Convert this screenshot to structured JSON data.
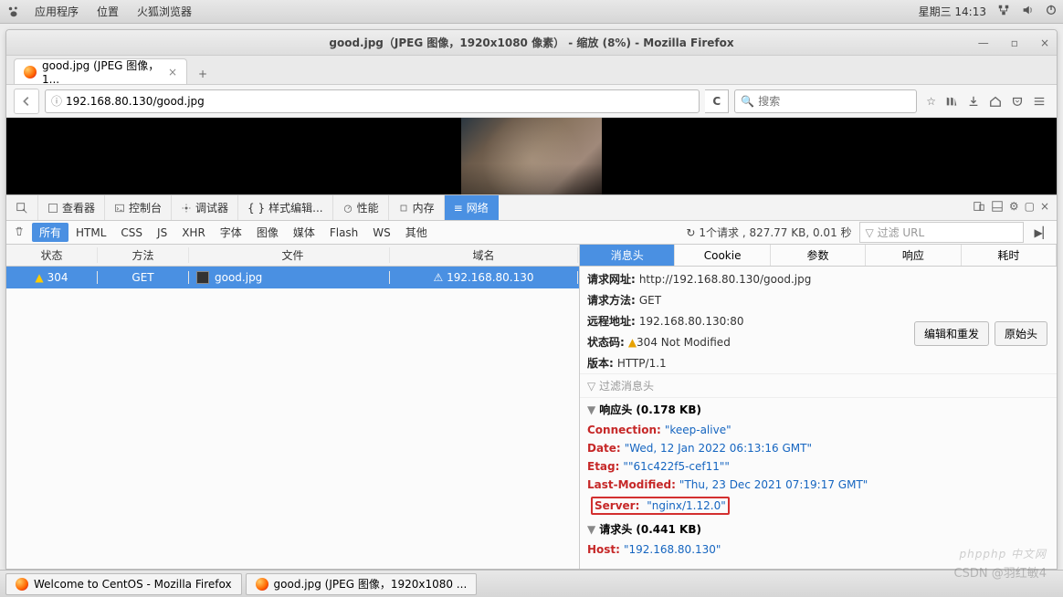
{
  "gnome": {
    "menu": [
      "应用程序",
      "位置",
      "火狐浏览器"
    ],
    "clock": "星期三  14:13"
  },
  "window": {
    "title": "good.jpg（JPEG 图像，1920x1080 像素）  - 缩放 (8%)  -  Mozilla Firefox"
  },
  "tab": {
    "label": "good.jpg (JPEG 图像，1...",
    "close": "×",
    "new": "+"
  },
  "urlbar": {
    "info": "ⓘ",
    "url": "192.168.80.130/good.jpg",
    "go": "C",
    "search_icon": "🔍",
    "search_placeholder": "搜索"
  },
  "devtools": {
    "tabs": {
      "inspector": "查看器",
      "console": "控制台",
      "debugger": "调试器",
      "style": "样式编辑...",
      "performance": "性能",
      "memory": "内存",
      "network": "网络"
    },
    "filters": {
      "all": "所有",
      "html": "HTML",
      "css": "CSS",
      "js": "JS",
      "xhr": "XHR",
      "fonts": "字体",
      "images": "图像",
      "media": "媒体",
      "flash": "Flash",
      "ws": "WS",
      "other": "其他"
    },
    "summary": "1个请求 , 827.77 KB, 0.01 秒",
    "filter_url_placeholder": "过滤 URL",
    "req_columns": {
      "status": "状态",
      "method": "方法",
      "file": "文件",
      "domain": "域名"
    },
    "request": {
      "status": "304",
      "method": "GET",
      "file": "good.jpg",
      "domain": "192.168.80.130"
    },
    "sidetabs": {
      "headers": "消息头",
      "cookies": "Cookie",
      "params": "参数",
      "response": "响应",
      "timing": "耗时"
    },
    "headers": {
      "url_k": "请求网址:",
      "url_v": "http://192.168.80.130/good.jpg",
      "method_k": "请求方法:",
      "method_v": "GET",
      "remote_k": "远程地址:",
      "remote_v": "192.168.80.130:80",
      "status_k": "状态码:",
      "status_v": "304 Not Modified",
      "version_k": "版本:",
      "version_v": "HTTP/1.1",
      "edit_btn": "编辑和重发",
      "raw_btn": "原始头",
      "filter_placeholder": "过滤消息头",
      "response_section": "响应头 (0.178 KB)",
      "connection_k": "Connection:",
      "connection_v": "\"keep-alive\"",
      "date_k": "Date:",
      "date_v": "\"Wed, 12 Jan 2022 06:13:16 GMT\"",
      "etag_k": "Etag:",
      "etag_v": "\"\"61c422f5-cef11\"\"",
      "lastmod_k": "Last-Modified:",
      "lastmod_v": "\"Thu, 23 Dec 2021 07:19:17 GMT\"",
      "server_k": "Server:",
      "server_v": "\"nginx/1.12.0\"",
      "request_section": "请求头 (0.441 KB)",
      "host_k": "Host:",
      "host_v": "\"192.168.80.130\""
    }
  },
  "taskbar": {
    "task1": "Welcome to CentOS - Mozilla Firefox",
    "task2": "good.jpg (JPEG 图像，1920x1080 ..."
  },
  "watermark": {
    "brand": "php 中文网",
    "php": "php",
    "author": "CSDN @羽红敏4"
  }
}
